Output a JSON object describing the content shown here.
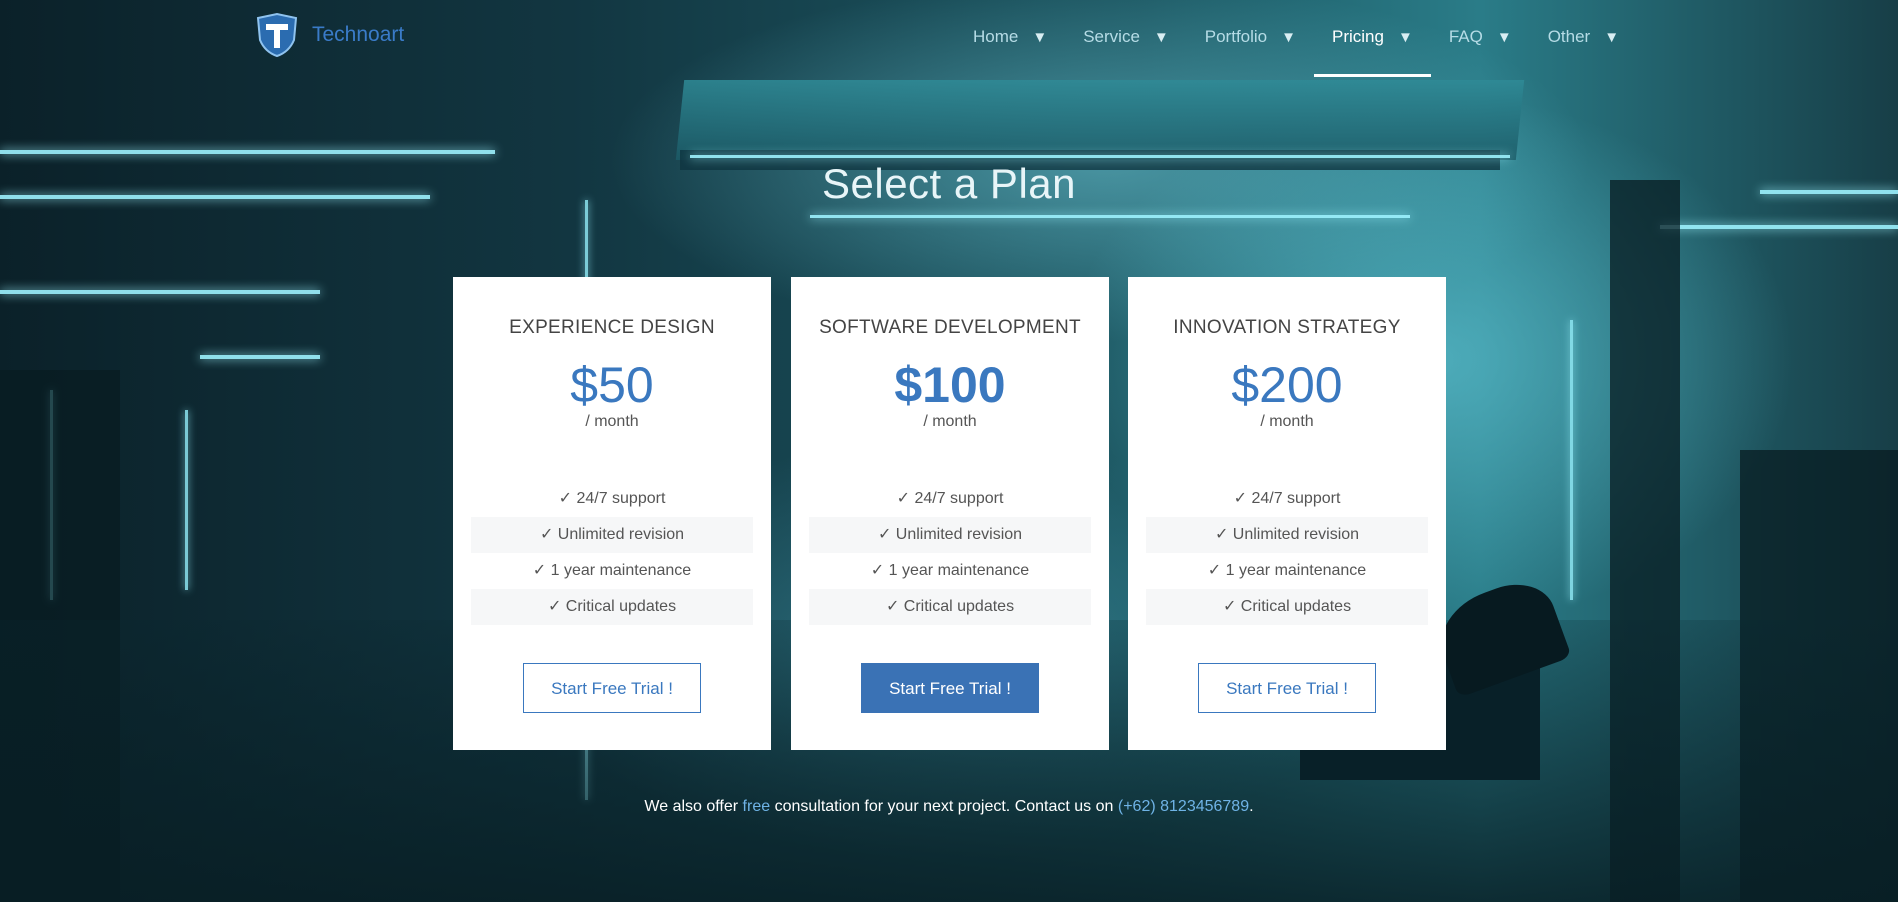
{
  "brand": {
    "name": "Technoart",
    "logo_icon": "shield-t-logo"
  },
  "nav": {
    "items": [
      {
        "label": "Home",
        "arrow": "▼",
        "active": false
      },
      {
        "label": "Service",
        "arrow": "▼",
        "active": false
      },
      {
        "label": "Portfolio",
        "arrow": "▼",
        "active": false
      },
      {
        "label": "Pricing",
        "arrow": "▼",
        "active": true
      },
      {
        "label": "FAQ",
        "arrow": "▼",
        "active": false
      },
      {
        "label": "Other",
        "arrow": "▼",
        "active": false
      }
    ]
  },
  "heading": "Select a Plan",
  "plans": [
    {
      "name": "EXPERIENCE DESIGN",
      "price": "$50",
      "period": "/ month",
      "features": [
        "✓ 24/7 support",
        "✓ Unlimited revision",
        "✓ 1 year maintenance",
        "✓ Critical updates"
      ],
      "cta": "Start Free Trial !",
      "featured": false
    },
    {
      "name": "SOFTWARE DEVELOPMENT",
      "price": "$100",
      "period": "/ month",
      "features": [
        "✓ 24/7 support",
        "✓ Unlimited revision",
        "✓ 1 year maintenance",
        "✓ Critical updates"
      ],
      "cta": "Start Free Trial !",
      "featured": true
    },
    {
      "name": "INNOVATION STRATEGY",
      "price": "$200",
      "period": "/ month",
      "features": [
        "✓ 24/7 support",
        "✓ Unlimited revision",
        "✓ 1 year maintenance",
        "✓ Critical updates"
      ],
      "cta": "Start Free Trial !",
      "featured": false
    }
  ],
  "footer": {
    "part1": "We also offer ",
    "free_link": "free",
    "part2": " consultation for your next project. Contact us on ",
    "phone_link": "(+62) 8123456789",
    "part3": "."
  },
  "colors": {
    "accent": "#3a78bf",
    "nav_text": "#b6dce6",
    "card_bg": "#ffffff"
  }
}
